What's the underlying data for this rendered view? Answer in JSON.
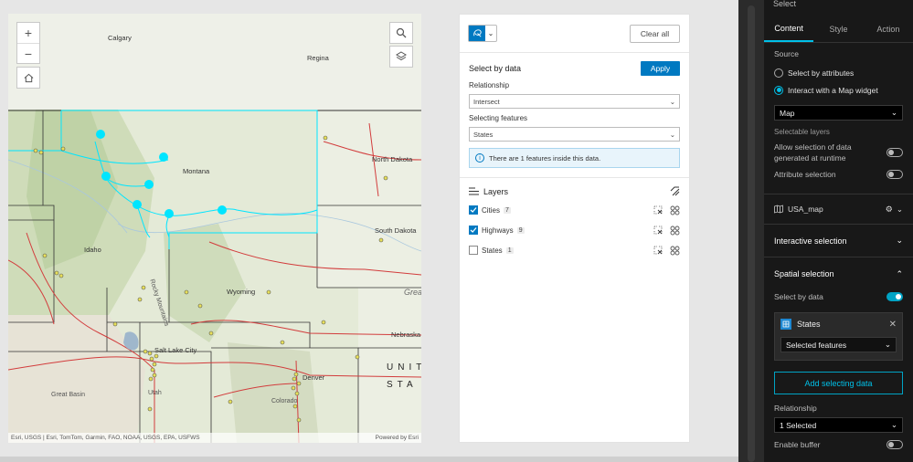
{
  "map": {
    "labels": {
      "calgary": "Calgary",
      "regina": "Regina",
      "montana": "Montana",
      "north_dakota": "North Dakota",
      "south_dakota": "South Dakota",
      "idaho": "Idaho",
      "wyoming": "Wyoming",
      "rocky_mountains": "Rocky Mountains",
      "nebraska": "Nebraska",
      "salt_lake_city": "Salt Lake City",
      "denver": "Denver",
      "utah": "Utah",
      "colorado": "Colorado",
      "great_basin": "Great Basin",
      "great": "Grea",
      "united": "UNIT",
      "states": "STA"
    },
    "attribution_left": "Esri, USGS | Esri, TomTom, Garmin, FAO, NOAA, USGS, EPA, USFWS",
    "attribution_right": "Powered by Esri",
    "zoom_in": "+",
    "zoom_out": "−"
  },
  "widget": {
    "clear_all": "Clear all",
    "select_by_data_title": "Select by data",
    "apply": "Apply",
    "relationship_label": "Relationship",
    "relationship_value": "Intersect",
    "selecting_features_label": "Selecting features",
    "selecting_features_value": "States",
    "info_text": "There are 1 features inside this data.",
    "layers_title": "Layers",
    "layers": [
      {
        "name": "Cities",
        "count": "7",
        "checked": true
      },
      {
        "name": "Highways",
        "count": "9",
        "checked": true
      },
      {
        "name": "States",
        "count": "1",
        "checked": false
      }
    ]
  },
  "settings": {
    "header": "Select",
    "tabs": [
      "Content",
      "Style",
      "Action"
    ],
    "source_label": "Source",
    "radio_attributes": "Select by attributes",
    "radio_map": "Interact with a Map widget",
    "map_select": "Map",
    "selectable_layers": "Selectable layers",
    "allow_runtime": "Allow selection of data generated at runtime",
    "attribute_selection": "Attribute selection",
    "usa_map": "USA_map",
    "interactive_selection": "Interactive selection",
    "spatial_selection": "Spatial selection",
    "select_by_data": "Select by data",
    "card_title": "States",
    "card_select": "Selected features",
    "add_selecting_data": "Add selecting data",
    "relationship_label": "Relationship",
    "relationship_value": "1 Selected",
    "enable_buffer": "Enable buffer"
  },
  "colors": {
    "accent_blue": "#0079c1",
    "cyan_highlight": "#00e5ff",
    "dark_accent": "#00c0e8"
  }
}
